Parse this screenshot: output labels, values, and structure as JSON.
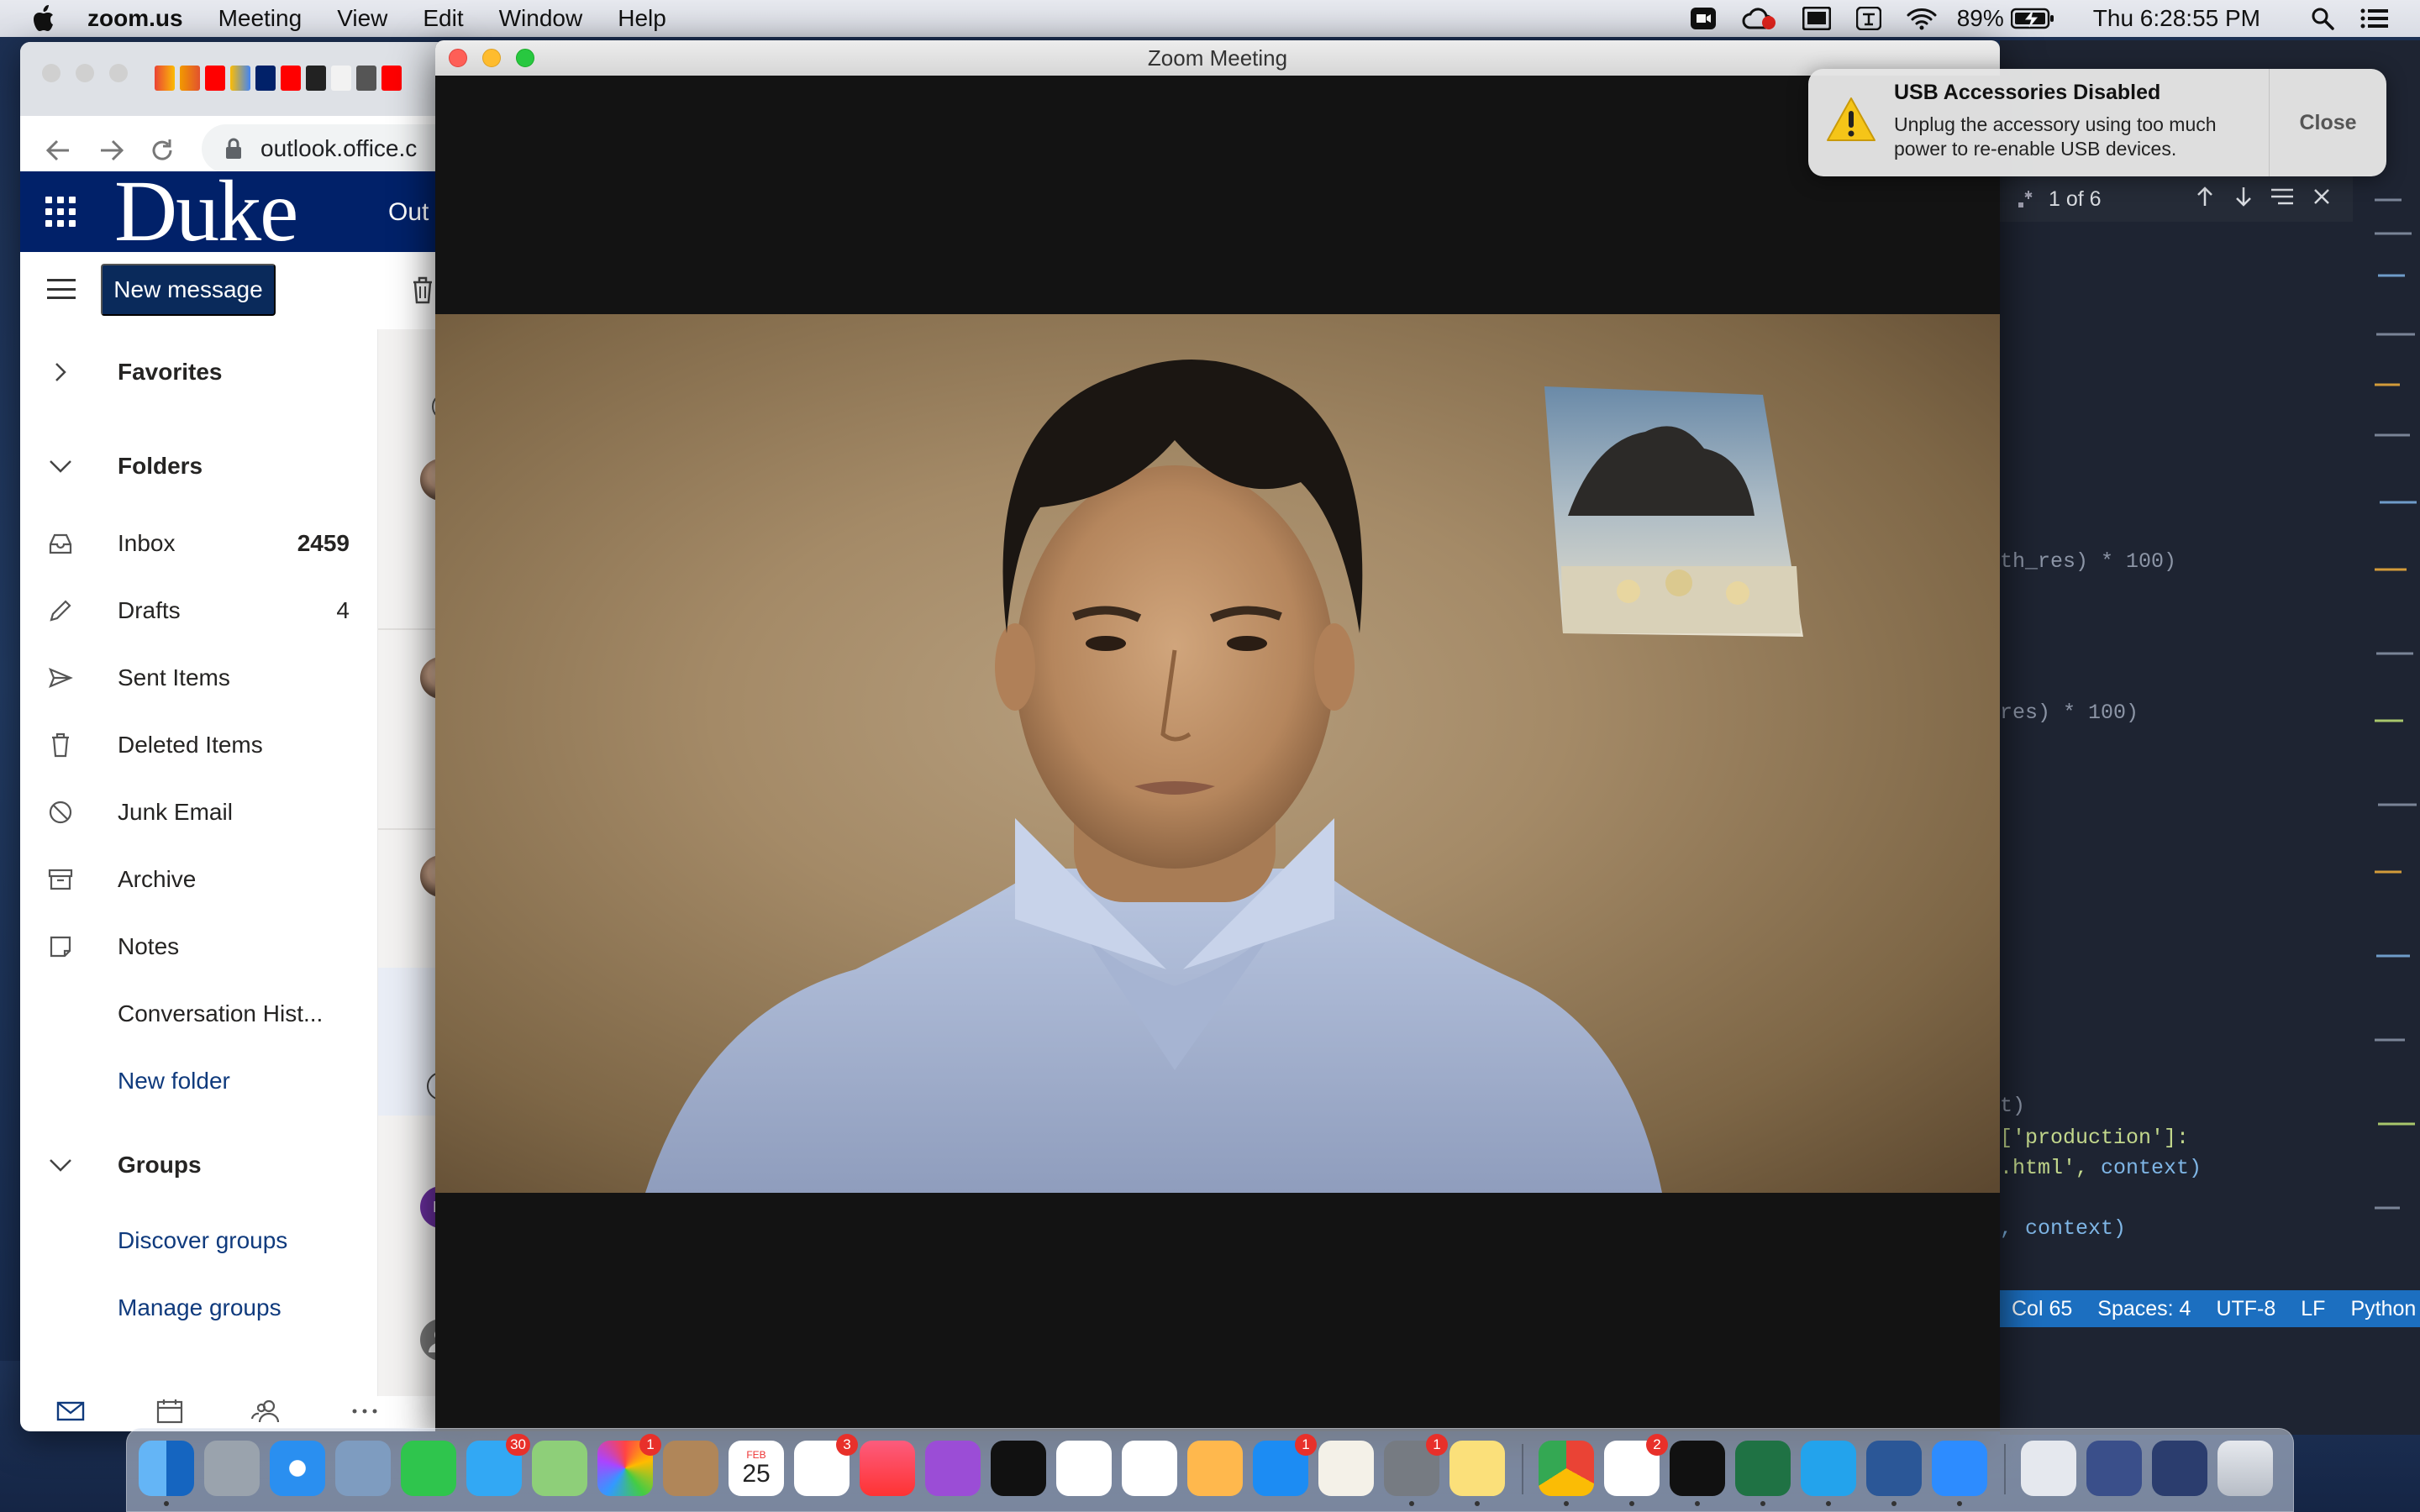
{
  "menubar": {
    "app_name": "zoom.us",
    "items": [
      "Meeting",
      "View",
      "Edit",
      "Window",
      "Help"
    ],
    "battery": "89%",
    "clock": "Thu 6:28:55 PM"
  },
  "browser": {
    "url": "outlook.office.c",
    "org_logo": "Duke",
    "app_title": "Out",
    "new_message": "New message",
    "folders": {
      "favorites": "Favorites",
      "folders_header": "Folders",
      "inbox": "Inbox",
      "inbox_count": "2459",
      "drafts": "Drafts",
      "drafts_count": "4",
      "sent": "Sent Items",
      "deleted": "Deleted Items",
      "junk": "Junk Email",
      "archive": "Archive",
      "notes": "Notes",
      "conversation_history": "Conversation Hist...",
      "new_folder": "New folder",
      "groups_header": "Groups",
      "discover_groups": "Discover groups",
      "manage_groups": "Manage groups"
    },
    "avatar_initials": "LT"
  },
  "zoom": {
    "window_title": "Zoom Meeting"
  },
  "notification": {
    "title": "USB Accessories Disabled",
    "body": "Unplug the accessory using too much power to re-enable USB devices.",
    "close": "Close"
  },
  "editor": {
    "find_result": "1 of 6",
    "code_lines": {
      "line1": "th_res) * 100)",
      "line2": "res) * 100)",
      "line3": "t)",
      "line4a": "['production']:",
      "line5a": ".html', ",
      "line5b": "context)",
      "line6": ", context)"
    },
    "status": {
      "col": "Col 65",
      "spaces": "Spaces: 4",
      "encoding": "UTF-8",
      "eol": "LF",
      "language": "Python"
    }
  },
  "dock": {
    "badges": {
      "messages": "30",
      "photos": "1",
      "calendar_day": "25",
      "calendar_month": "FEB",
      "reminders": "3",
      "app_store": "1",
      "system_prefs": "1",
      "slack": "2"
    }
  },
  "colors": {
    "duke_blue": "#012169",
    "zoom_bg": "#131313",
    "editor_status": "#1c6fc0"
  }
}
